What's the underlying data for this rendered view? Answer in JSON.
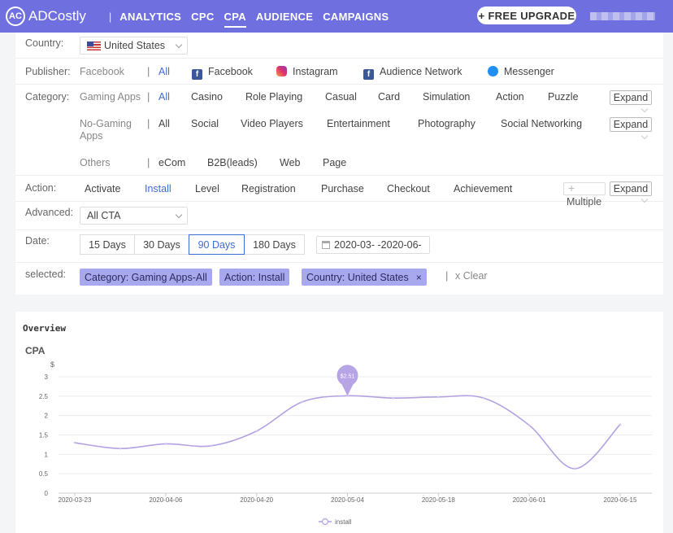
{
  "topbar": {
    "brand": "ADCostly",
    "brand_mark": "AC",
    "separator": "|",
    "nav": [
      "ANALYTICS",
      "CPC",
      "CPA",
      "AUDIENCE",
      "CAMPAIGNS"
    ],
    "active_nav": "CPA",
    "upgrade_label": "+ FREE UPGRADE",
    "accent": "#6f6fe0"
  },
  "filters": {
    "country": {
      "label": "Country:",
      "value": "United States"
    },
    "publisher": {
      "label": "Publisher:",
      "sublabel": "Facebook",
      "options": [
        "All",
        "Facebook",
        "Instagram",
        "Audience Network",
        "Messenger"
      ],
      "selected": "All"
    },
    "category": {
      "label": "Category:",
      "gaming_label": "Gaming Apps",
      "gaming_options": [
        "All",
        "Casino",
        "Role Playing",
        "Casual",
        "Card",
        "Simulation",
        "Action",
        "Puzzle"
      ],
      "gaming_selected": "All",
      "nongaming_label": "No-Gaming Apps",
      "nongaming_options": [
        "All",
        "Social",
        "Video Players",
        "Entertainment",
        "Photography",
        "Social Networking"
      ],
      "others_label": "Others",
      "others_options": [
        "eCom",
        "B2B(leads)",
        "Web",
        "Page"
      ],
      "expand_label": "Expand"
    },
    "action": {
      "label": "Action:",
      "options": [
        "Activate",
        "Install",
        "Level",
        "Registration",
        "Purchase",
        "Checkout",
        "Achievement"
      ],
      "selected": "Install",
      "multiple_label": "Multiple",
      "multiple_plus": "+",
      "expand_label": "Expand"
    },
    "advanced": {
      "label": "Advanced:",
      "value": "All CTA"
    },
    "date": {
      "label": "Date:",
      "options": [
        "15 Days",
        "30 Days",
        "90 Days",
        "180 Days"
      ],
      "selected": "90 Days",
      "range": "2020-03- -2020-06-"
    },
    "selected": {
      "label": "selected:",
      "tags": [
        "Category:  Gaming Apps-All",
        "Action:  Install",
        "Country:  United States"
      ],
      "close_glyph": "×",
      "clear_label": "x Clear"
    }
  },
  "overview": {
    "title": "Overview",
    "tooltip": "$2.51",
    "line_color": "#b3a1e2"
  },
  "chart_data": {
    "type": "line",
    "title": "CPA",
    "ylabel": "$",
    "ylim": [
      0,
      3
    ],
    "yticks": [
      "0",
      "0.5",
      "1",
      "1.5",
      "2",
      "2.5",
      "3"
    ],
    "xticks": [
      "2020-03-23",
      "2020-04-06",
      "2020-04-20",
      "2020-05-04",
      "2020-05-18",
      "2020-06-01",
      "2020-06-15"
    ],
    "series": [
      {
        "name": "Install",
        "x": [
          "2020-03-23",
          "2020-03-30",
          "2020-04-06",
          "2020-04-13",
          "2020-04-20",
          "2020-04-27",
          "2020-05-04",
          "2020-05-11",
          "2020-05-18",
          "2020-05-25",
          "2020-06-01",
          "2020-06-08",
          "2020-06-15"
        ],
        "values": [
          1.3,
          1.15,
          1.27,
          1.22,
          1.6,
          2.35,
          2.51,
          2.45,
          2.48,
          2.45,
          1.75,
          0.63,
          1.77
        ]
      }
    ],
    "legend": "bottom"
  }
}
